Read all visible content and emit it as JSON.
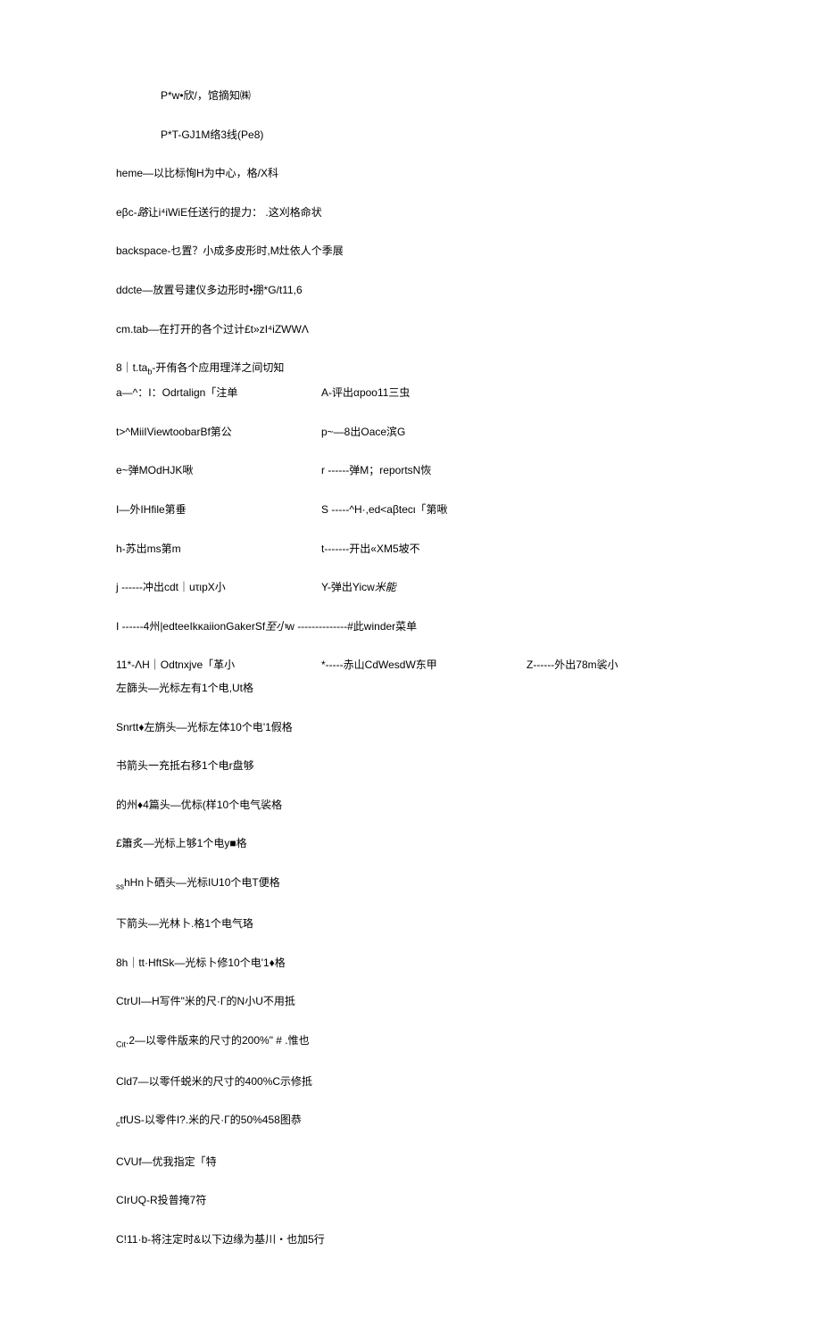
{
  "l1": "P*w•欣/，馆摘知㈱",
  "l2": "P*T-GJ1M络3线(Pe8)",
  "l3": "heme—以比标恂H为中心，格/X科",
  "l4_a": "eβc-",
  "l4_b": "路",
  "l4_c": "让i⁴iWiE任送行的提力： .这刈格命状",
  "l5": "backspace-乜置？小成多皮形时,M灶依人个季展",
  "l6": "ddcte—放置号建仪多边形时•掤*G/t11,6",
  "l7": "cm.tab—在打开的各个过计£t»zI⁴iZWWΛ",
  "l8_a": "8｜t.ta",
  "l8_b": "b",
  "l8_c": "-开侑各个应用理洋之间切知",
  "row_a_l": "a—^：I：Odrtalign「注单",
  "row_a_r": "A-评出αpoo11三虫",
  "row_t_l": "t>^MiiIViewtoobarBf第公",
  "row_t_r": "p~—8出Oace滨G",
  "row_e_l": "e~弹MOdHJK啾",
  "row_e_r": "r ------弹M；reportsN恢",
  "row_i_l": "I—外IHfile第垂",
  "row_i_r": "S -----^H·,ed<aβtecι「第啾",
  "row_h_l": "h-苏出ms第m",
  "row_h_r": "t-------开出«XM5坡不",
  "row_j_l": "j ------冲出cdt｜uτιpX小",
  "row_j_r_a": "Y-弹出Yicw",
  "row_j_r_b": "米能",
  "l_sep_a": "I ------4州|edteeIkκaiionGakerSf",
  "l_sep_b": "至小",
  "l_sep_c": "w --------------#此winder菜单",
  "row11_a": "11*-ΛH｜Odtnxjve「革小",
  "row11_b": "*-----赤山CdWesdW东甲",
  "row11_c": "Z------外出78m裟小",
  "lzj": "左篩头—光标左有1个电,Ut格",
  "sn": "Snrtt♦左旃头—光标左体10个电'1假格",
  "sh": "书箭头一充抵右移1个电r盘够",
  "dz": "的州♦4篇头—优标(样10个电气裟格",
  "xj": "£簫炙—光标上够1个电y■格",
  "ss_a": "ss",
  "ss_b": "hHn卜硒头—光标IU10个电T便格",
  "xj2": "下箭头—光林卜.格1个电气珞",
  "h8": "8h｜tt·HftSk—光标卜修10个电'1♦格",
  "cu": "CtrUI—H写件\"米的尺·Γ的N小U不用抵",
  "cit_a": "Cιt",
  "cit_b": ".2—以零件版来的尺寸的200%\" # .惟也",
  "cd7": "Cld7—以零仟蜕米的尺寸的400%C示修抵",
  "ctf_a": "c",
  "ctf_b": "tfUS-以零件I?.米的尺·Γ的50%458图恭",
  "cvu": "CVUf—优我指定「特",
  "cir": "CIrUQ-R投普掩7符",
  "ci11": "C!11·b-将注定时&以下边缘为基川・也加5行"
}
